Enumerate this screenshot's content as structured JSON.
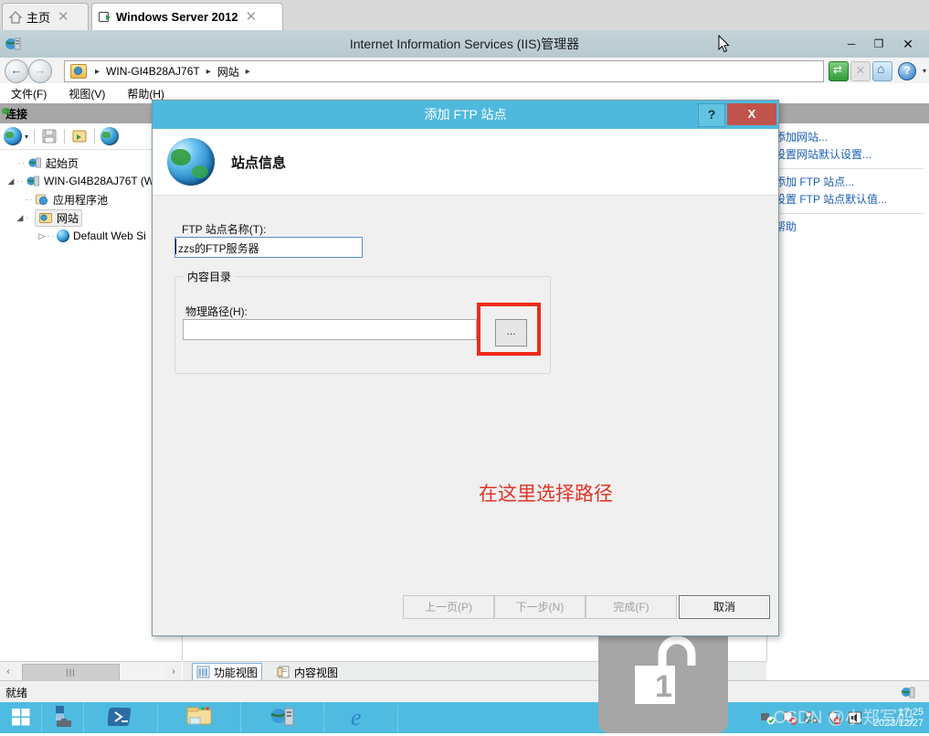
{
  "browser": {
    "tabs": [
      {
        "label": "主页",
        "icon": "home-icon",
        "close": "✕"
      },
      {
        "label": "Windows Server 2012",
        "icon": "vm-screen-icon",
        "close": "✕"
      }
    ]
  },
  "window": {
    "title": "Internet Information Services (IIS)管理器",
    "minimize": "─",
    "maximize": "❐",
    "close": "✕",
    "icon": "iis-server-icon"
  },
  "addressbar": {
    "back": "←",
    "forward": "→",
    "crumbs": [
      "WIN-GI4B28AJ76T",
      "网站"
    ],
    "separator": "▸",
    "icons": [
      "refresh-icon",
      "stop-icon",
      "home-icon",
      "help-icon"
    ],
    "dropdown": "▾"
  },
  "menubar": {
    "items": [
      "文件(F)",
      "视图(V)",
      "帮助(H)"
    ]
  },
  "leftpane": {
    "header": "连接",
    "toolbar_icons": [
      "connect-to-globe-icon",
      "dropdown-arrow-icon",
      "save-icon",
      "app-pools-icon",
      "disconnect-icon"
    ],
    "dropdown": "▾",
    "tree": [
      {
        "label": "起始页",
        "indent": 1,
        "arrow": "",
        "icon": "start-page-icon",
        "selected": false
      },
      {
        "label": "WIN-GI4B28AJ76T (W",
        "indent": 0,
        "arrow": "◢",
        "icon": "server-icon",
        "selected": false
      },
      {
        "label": "应用程序池",
        "indent": 1,
        "arrow": "",
        "icon": "app-pool-icon",
        "selected": false
      },
      {
        "label": "网站",
        "indent": 1,
        "arrow": "◢",
        "icon": "sites-folder-icon",
        "selected": true
      },
      {
        "label": "Default Web Si",
        "indent": 2,
        "arrow": "▷",
        "icon": "website-globe-icon",
        "selected": false
      }
    ]
  },
  "rightpane": {
    "groups": [
      [
        "添加网站...",
        "设置网站默认设置..."
      ],
      [
        "添加 FTP 站点...",
        "设置 FTP 站点默认值..."
      ],
      [
        "帮助"
      ]
    ]
  },
  "viewtabs": [
    {
      "label": "功能视图",
      "icon": "features-view-icon",
      "selected": true
    },
    {
      "label": "内容视图",
      "icon": "content-view-icon",
      "selected": false
    }
  ],
  "scrollbar": {
    "left_arrow": "‹",
    "right_arrow": "›",
    "thumb": "|||"
  },
  "statusbar": {
    "text": "就绪",
    "icon": "iis-status-icon"
  },
  "dialog": {
    "title": "添加 FTP 站点",
    "help_button": "?",
    "close_button": "X",
    "heading": "站点信息",
    "heading_icon": "globe-icon",
    "ftp_name_label": "FTP 站点名称(T):",
    "ftp_name_value": "zzs的FTP服务器",
    "group_title": "内容目录",
    "path_label": "物理路径(H):",
    "path_value": "",
    "browse_button": "...",
    "annotation": "在这里选择路径",
    "annotation_color": "#e03425",
    "highlight_color": "#ee2b16",
    "buttons": [
      {
        "label": "上一页(P)",
        "enabled": false
      },
      {
        "label": "下一步(N)",
        "enabled": false
      },
      {
        "label": "完成(F)",
        "enabled": false
      },
      {
        "label": "取消",
        "enabled": true
      }
    ]
  },
  "taskbar": {
    "items": [
      {
        "icon": "windows-start-icon",
        "name": "start-button"
      },
      {
        "icon": "server-manager-icon",
        "name": "server-manager"
      },
      {
        "icon": "powershell-icon",
        "name": "powershell"
      },
      {
        "icon": "file-explorer-icon",
        "name": "file-explorer"
      },
      {
        "icon": "iis-manager-icon",
        "name": "iis-manager"
      },
      {
        "icon": "internet-explorer-icon",
        "name": "internet-explorer"
      }
    ],
    "tray_icons": [
      "network-ok-icon",
      "flag-alert-icon",
      "network-icon",
      "action-center-icon",
      "volume-icon"
    ],
    "clock_time": "17:25",
    "clock_date": "2023/12/27"
  },
  "overlays": {
    "watermark": "CSDN @小郑写码",
    "lock_badge": "1",
    "lock_icon": "unlocked-padlock-icon"
  }
}
